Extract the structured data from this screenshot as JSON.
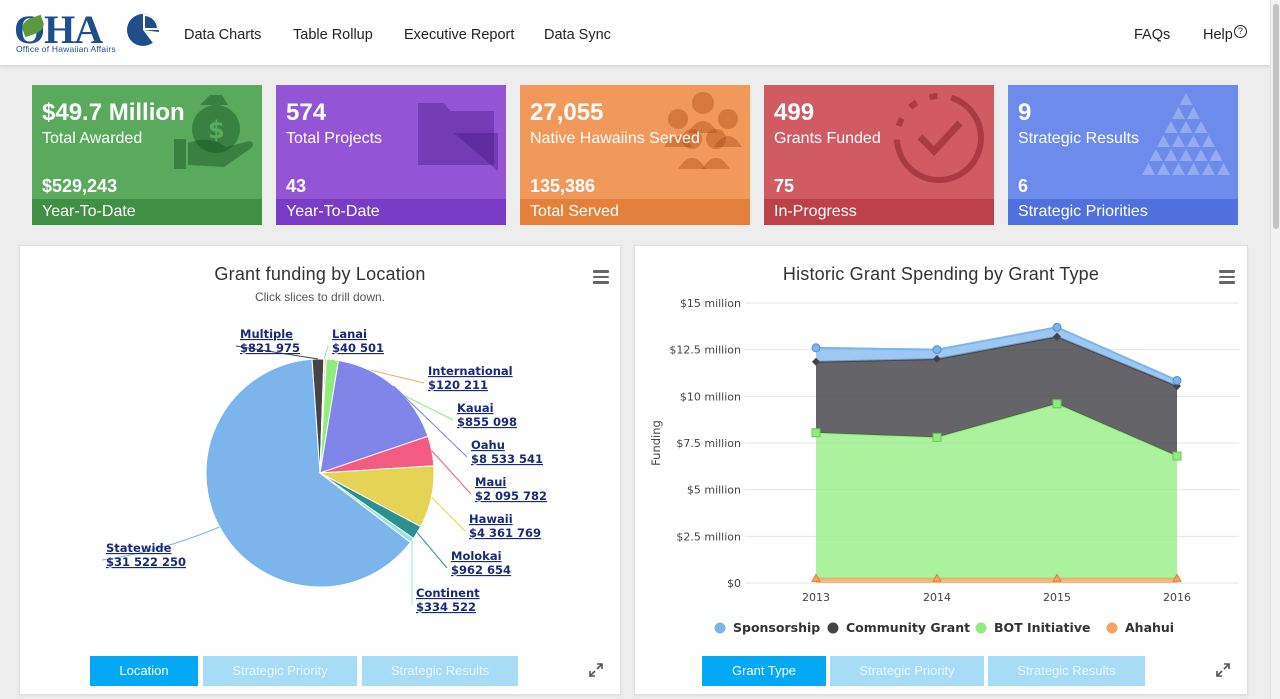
{
  "nav": {
    "logo_text": "OHA",
    "logo_subtitle": "Office of Hawaiian Affairs",
    "items": [
      "Data Charts",
      "Table Rollup",
      "Executive Report",
      "Data Sync"
    ],
    "faqs": "FAQs",
    "help": "Help",
    "help_icon": "?"
  },
  "stats": [
    {
      "big": "$49.7 Million",
      "label": "Total Awarded",
      "value2": "$529,243",
      "footer": "Year-To-Date",
      "color": "#5aaa5e",
      "footer_color": "#3f9044",
      "icon": "money-hand-icon"
    },
    {
      "big": "574",
      "label": "Total Projects",
      "value2": "43",
      "footer": "Year-To-Date",
      "color": "#9355d6",
      "footer_color": "#7a3cc5",
      "icon": "folder-ruler-icon"
    },
    {
      "big": "27,055",
      "label": "Native Hawaiins Served",
      "value2": "135,386",
      "footer": "Total Served",
      "color": "#f0995a",
      "footer_color": "#e3813c",
      "icon": "people-group-icon"
    },
    {
      "big": "499",
      "label": "Grants Funded",
      "value2": "75",
      "footer": "In-Progress",
      "color": "#d05b63",
      "footer_color": "#bd4149",
      "icon": "check-circle-icon"
    },
    {
      "big": "9",
      "label": "Strategic Results",
      "value2": "6",
      "footer": "Strategic Priorities",
      "color": "#6c8bea",
      "footer_color": "#4f70dd",
      "icon": "triangle-pyramid-icon"
    }
  ],
  "pie_panel": {
    "title": "Grant funding by Location",
    "subtitle": "Click slices to drill down.",
    "tabs": [
      "Location",
      "Strategic Priority",
      "Strategic Results"
    ]
  },
  "area_panel": {
    "title": "Historic Grant Spending by Grant Type",
    "tabs": [
      "Grant Type",
      "Strategic Priority",
      "Strategic Results"
    ]
  },
  "chart_data": [
    {
      "type": "pie",
      "title": "Grant funding by Location",
      "subtitle": "Click slices to drill down.",
      "slices": [
        {
          "name": "Statewide",
          "label": "$31 522 250",
          "value": 31522250,
          "color": "#7cb5ec"
        },
        {
          "name": "Multiple",
          "label": "$821 975",
          "value": 821975,
          "color": "#434348"
        },
        {
          "name": "Lanai",
          "label": "$40 501",
          "value": 40501,
          "color": "#90ed7d"
        },
        {
          "name": "International",
          "label": "$120 211",
          "value": 120211,
          "color": "#f7a35c"
        },
        {
          "name": "Kauai",
          "label": "$855 098",
          "value": 855098,
          "color": "#90ed7d"
        },
        {
          "name": "Oahu",
          "label": "$8 533 541",
          "value": 8533541,
          "color": "#8085e9"
        },
        {
          "name": "Maui",
          "label": "$2 095 782",
          "value": 2095782,
          "color": "#f15c80"
        },
        {
          "name": "Hawaii",
          "label": "$4 361 769",
          "value": 4361769,
          "color": "#e4d354"
        },
        {
          "name": "Molokai",
          "label": "$962 654",
          "value": 962654,
          "color": "#2b908f"
        },
        {
          "name": "Continent",
          "label": "$334 522",
          "value": 334522,
          "color": "#91e8e1"
        }
      ]
    },
    {
      "type": "area",
      "title": "Historic Grant Spending by Grant Type",
      "ylabel": "Funding",
      "categories": [
        "2013",
        "2014",
        "2015",
        "2016"
      ],
      "ylim": [
        0,
        15
      ],
      "yticks": [
        "$0",
        "$2.5 million",
        "$5 million",
        "$7.5 million",
        "$10 million",
        "$12.5 million",
        "$15 million"
      ],
      "stacked": true,
      "grid": true,
      "legend_position": "bottom",
      "series": [
        {
          "name": "Ahahui",
          "values": [
            0.25,
            0.25,
            0.25,
            0.25
          ],
          "color": "#f7a35c"
        },
        {
          "name": "BOT Initiative",
          "values": [
            7.8,
            7.55,
            9.35,
            6.55
          ],
          "color": "#90ed7d"
        },
        {
          "name": "Community Grant",
          "values": [
            3.8,
            4.2,
            3.6,
            3.75
          ],
          "color": "#434348"
        },
        {
          "name": "Sponsorship",
          "values": [
            0.75,
            0.5,
            0.5,
            0.3
          ],
          "color": "#7cb5ec"
        }
      ],
      "legend": [
        "Sponsorship",
        "Community Grant",
        "BOT Initiative",
        "Ahahui"
      ]
    }
  ]
}
